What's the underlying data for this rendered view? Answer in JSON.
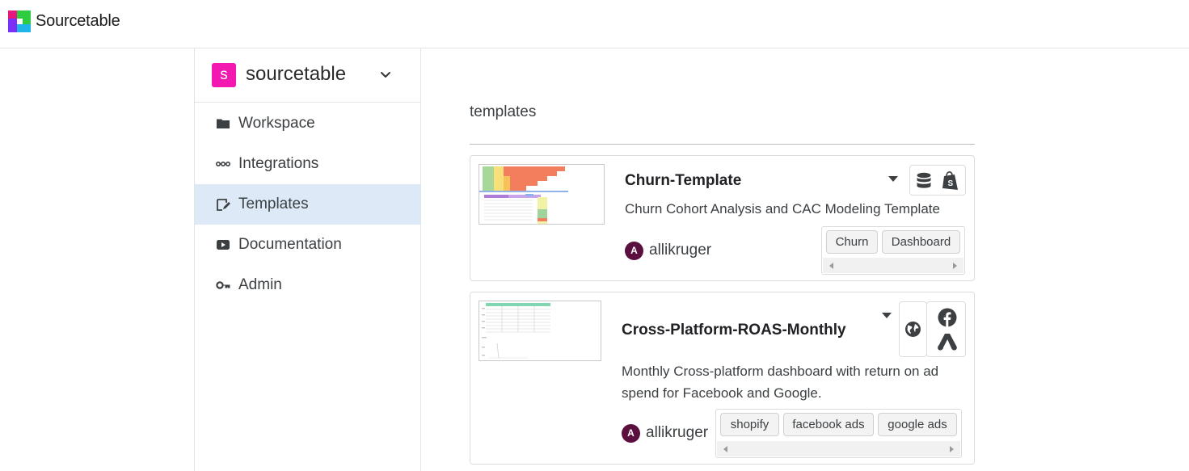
{
  "app": {
    "name": "Sourcetable"
  },
  "workspace": {
    "badge": "s",
    "name": "sourcetable"
  },
  "sidebar": {
    "items": [
      {
        "label": "Workspace",
        "icon": "folder-icon",
        "active": false
      },
      {
        "label": "Integrations",
        "icon": "integrations-icon",
        "active": false
      },
      {
        "label": "Templates",
        "icon": "template-icon",
        "active": true
      },
      {
        "label": "Documentation",
        "icon": "video-icon",
        "active": false
      },
      {
        "label": "Admin",
        "icon": "key-icon",
        "active": false
      }
    ]
  },
  "main": {
    "section_title": "templates",
    "templates": [
      {
        "title": "Churn-Template",
        "description": "Churn Cohort Analysis and CAC Modeling Template",
        "author_initial": "A",
        "author": "allikruger",
        "source_icons": [
          "database-icon",
          "shopify-icon"
        ],
        "tags": [
          "Churn",
          "Dashboard"
        ]
      },
      {
        "title": "Cross-Platform-ROAS-Monthly",
        "description": "Monthly Cross-platform dashboard with return on ad spend for Facebook and Google.",
        "author_initial": "A",
        "author": "allikruger",
        "source_icons": [
          "globe-icon",
          "facebook-icon",
          "google-ads-icon"
        ],
        "tags": [
          "shopify",
          "facebook ads",
          "google ads"
        ]
      }
    ]
  },
  "colors": {
    "accent": "#f318b0",
    "active_nav": "#dde9f6",
    "avatar": "#5b0f3f"
  }
}
